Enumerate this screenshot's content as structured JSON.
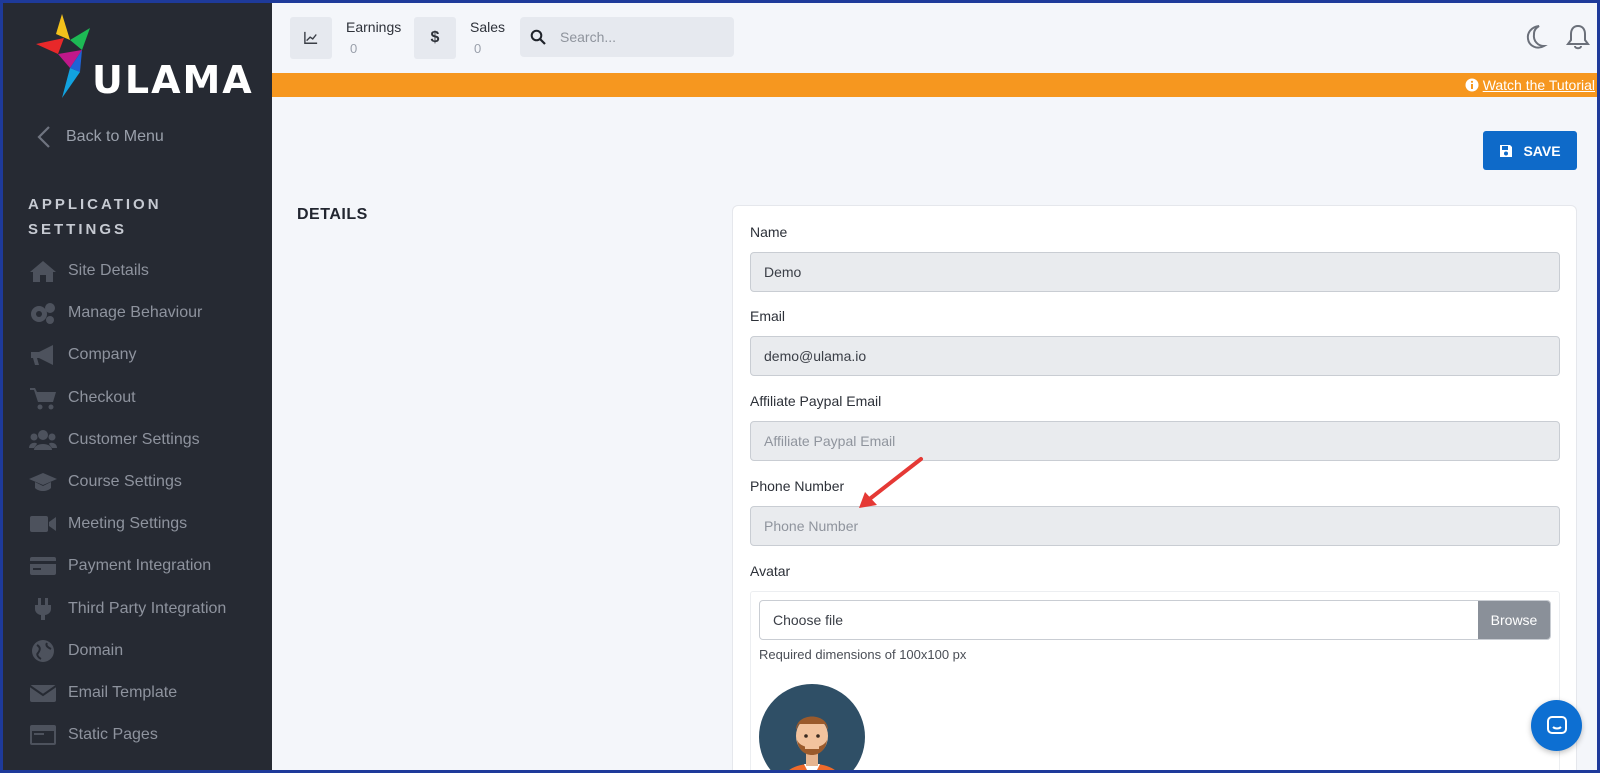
{
  "brand": {
    "logo_text": "ULAMA"
  },
  "sidebar": {
    "back_label": "Back to Menu",
    "section_title": "APPLICATION SETTINGS",
    "items": [
      {
        "label": "Site Details",
        "icon": "home-icon"
      },
      {
        "label": "Manage Behaviour",
        "icon": "gears-icon"
      },
      {
        "label": "Company",
        "icon": "megaphone-icon"
      },
      {
        "label": "Checkout",
        "icon": "cart-icon"
      },
      {
        "label": "Customer Settings",
        "icon": "users-icon"
      },
      {
        "label": "Course Settings",
        "icon": "graduation-cap-icon"
      },
      {
        "label": "Meeting Settings",
        "icon": "video-icon"
      },
      {
        "label": "Payment Integration",
        "icon": "credit-card-icon"
      },
      {
        "label": "Third Party Integration",
        "icon": "plug-icon"
      },
      {
        "label": "Domain",
        "icon": "globe-icon"
      },
      {
        "label": "Email Template",
        "icon": "envelope-icon"
      },
      {
        "label": "Static Pages",
        "icon": "window-icon"
      }
    ]
  },
  "topbar": {
    "earnings": {
      "label": "Earnings",
      "value": "0"
    },
    "sales": {
      "label": "Sales",
      "value": "0"
    },
    "search_placeholder": "Search..."
  },
  "banner": {
    "tutorial_link": "Watch the Tutorial",
    "color": "#f6971f"
  },
  "main": {
    "save_label": "SAVE",
    "section_title": "DETAILS",
    "form": {
      "name": {
        "label": "Name",
        "value": "Demo"
      },
      "email": {
        "label": "Email",
        "value": "demo@ulama.io"
      },
      "paypal": {
        "label": "Affiliate Paypal Email",
        "placeholder": "Affiliate Paypal Email"
      },
      "phone": {
        "label": "Phone Number",
        "placeholder": "Phone Number"
      },
      "avatar": {
        "label": "Avatar",
        "file_text": "Choose file",
        "browse_label": "Browse",
        "hint": "Required dimensions of 100x100 px"
      }
    }
  },
  "colors": {
    "accent": "#0e6ac9",
    "sidebar_bg": "#262a33",
    "annotation": "#e53935"
  }
}
